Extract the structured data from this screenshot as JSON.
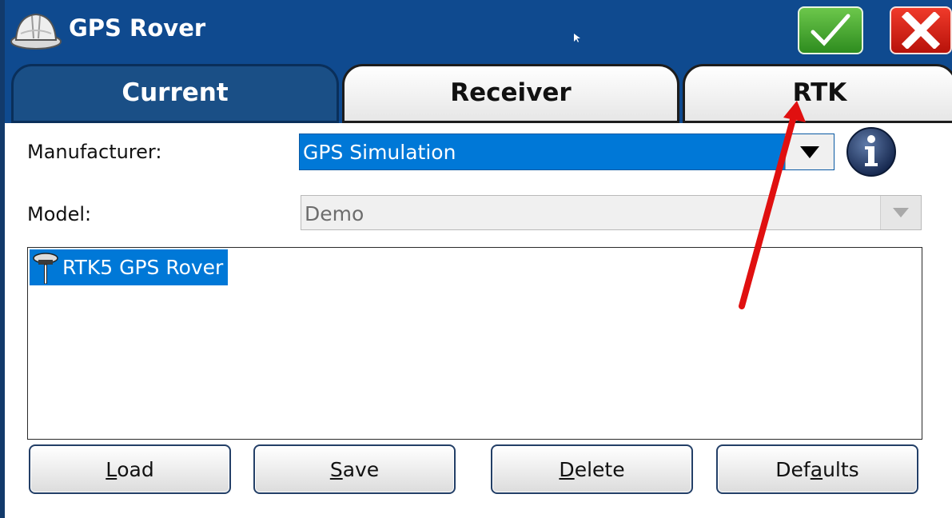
{
  "window": {
    "title": "GPS Rover",
    "ok_icon": "checkmark-icon",
    "close_icon": "close-x-icon"
  },
  "tabs": [
    {
      "label": "Current",
      "active": true
    },
    {
      "label": "Receiver",
      "active": false
    },
    {
      "label": "RTK",
      "active": false
    }
  ],
  "form": {
    "manufacturer_label": "Manufacturer:",
    "manufacturer_value": "GPS Simulation",
    "model_label": "Model:",
    "model_value": "Demo"
  },
  "list": {
    "items": [
      {
        "label": "RTK5 GPS Rover",
        "selected": true
      }
    ]
  },
  "buttons": {
    "load": {
      "accel": "L",
      "rest": "oad"
    },
    "save": {
      "accel": "S",
      "rest": "ave"
    },
    "delete": {
      "accel": "D",
      "rest": "elete"
    },
    "defaults": {
      "pre": "Def",
      "accel": "a",
      "rest": "ults"
    }
  },
  "colors": {
    "titlebar": "#0f4a8f",
    "selection": "#0078d7",
    "annotation_arrow": "#e01010"
  }
}
